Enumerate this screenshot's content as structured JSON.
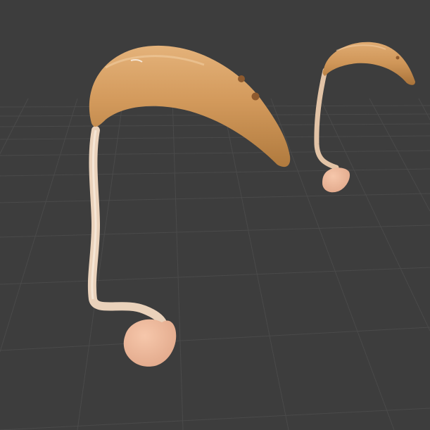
{
  "viewport": {
    "background_color": "#3d3d3d",
    "grid_line_color": "#4a4a4a",
    "grid_visible": true
  },
  "objects": [
    {
      "name": "hearing-aid-foreground",
      "shell_color": "#d39a5c",
      "tube_color": "#e8cbb0",
      "earpiece_color": "#f0b89a"
    },
    {
      "name": "hearing-aid-background",
      "shell_color": "#d39a5c",
      "tube_color": "#e8cbb0",
      "earpiece_color": "#f0b89a"
    }
  ]
}
